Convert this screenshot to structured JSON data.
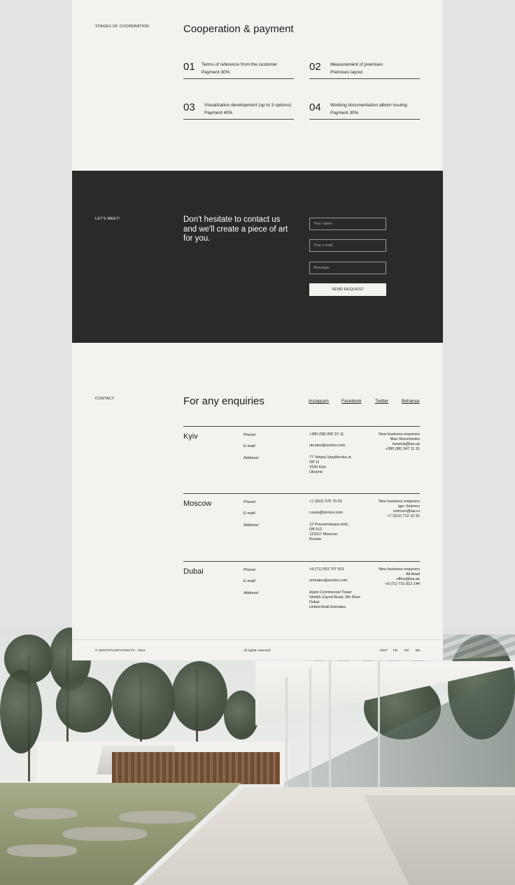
{
  "stages": {
    "section_label": "STAGES OF COOPERATION",
    "title": "Cooperation & payment",
    "items": [
      {
        "num": "01",
        "line1": "Terms of reference from the customer",
        "line2": "Payment 30%"
      },
      {
        "num": "02",
        "line1": "Measurement of premises",
        "line2": "Premises layout"
      },
      {
        "num": "03",
        "line1": "Visualization development (up to 3 options)",
        "line2": "Payment 40%"
      },
      {
        "num": "04",
        "line1": "Working documentation albom issuing",
        "line2": "Payment 30%"
      }
    ]
  },
  "meet": {
    "section_label": "LET'S MEET!",
    "cta": "Don't hesitate to contact us and we'll create a piece of art for you.",
    "name_placeholder": "Your name",
    "email_placeholder": "Your e-mail",
    "message_placeholder": "Message",
    "send_label": "SEND REQUEST"
  },
  "contact": {
    "section_label": "CONTACT",
    "title": "For any enquiries",
    "social": [
      "Instagram",
      "Facebook",
      "Twitter",
      "Behance"
    ],
    "labels": {
      "phone": "Phone/",
      "email": "E-mail/",
      "address": "Address/"
    },
    "offices": [
      {
        "city": "Kyiv",
        "phone": "+380 (68) 000 10 11",
        "email": "ukraine@sirotov.com",
        "address": [
          "77 Velyka Vasylkivska st.",
          "Off 11",
          "3150 Kyiv",
          "Ukraine"
        ],
        "biz": [
          "New business enquirers",
          "Max Shevchenko",
          "newenq@isa.ua",
          "+380 (96) 347 11 31"
        ]
      },
      {
        "city": "Moscow",
        "phone": "+7 (922) 375 70 03",
        "email": "russia@sirotov.com",
        "address": [
          "12 Presnenskaya emb.,",
          "Off 312",
          "123317 Moscow",
          "Russia"
        ],
        "biz": [
          "New business enquirers",
          "Igor Smirnov",
          "smirnov@isa.ru",
          "+7 (912) 712 10 91"
        ]
      },
      {
        "city": "Dubai",
        "phone": "+9 (71) 553 707 601",
        "email": "emirates@sirotov.com",
        "address": [
          "Aspin Commercial Tower",
          "Sheikh Zayed Road, 5th Floor",
          "Dubai",
          "United Arab Emirates"
        ],
        "biz": [
          "New business enquirers",
          "Ali Asad",
          "office@isa.ae",
          "+9 (71) 731 812 144"
        ]
      }
    ]
  },
  "footer": {
    "copyright": "© SIROTOVARCHITECTS - 2021",
    "rights": "All rights reserved",
    "links": [
      "INST",
      "FB",
      "TW",
      "BE"
    ]
  }
}
